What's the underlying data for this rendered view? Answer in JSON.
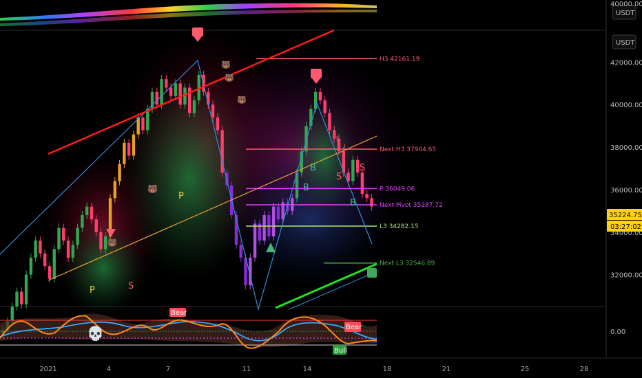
{
  "chart_data": {
    "type": "candlestick",
    "symbol_unit": "USDT",
    "x_ticks": [
      "2021",
      "4",
      "7",
      "11",
      "14",
      "18",
      "21",
      "25",
      "28"
    ],
    "y_ticks": [
      "42000.00",
      "40000.00",
      "38000.00",
      "36000.00",
      "34000.00",
      "32000.00"
    ],
    "top_pane_tick": "40000.00",
    "osc_tick": "0.00",
    "y_range": [
      30500,
      43500
    ],
    "last_price": "35224.75",
    "countdown": "03:27:02",
    "levels": [
      {
        "label": "H3 42161.19",
        "value": 42161.19,
        "color": "#ff5a6e"
      },
      {
        "label": "Next H3 37904.65",
        "value": 37904.65,
        "color": "#ff5a6e"
      },
      {
        "label": "P 36049.06",
        "value": 36049.06,
        "color": "#e040fb"
      },
      {
        "label": "Next Pivot 35287.72",
        "value": 35287.72,
        "color": "#e040fb"
      },
      {
        "label": "L3 34282.15",
        "value": 34282.15,
        "color": "#b6e36b"
      },
      {
        "label": "Next L3 32546.89",
        "value": 32546.89,
        "color": "#4caf50"
      }
    ],
    "series_close": [
      29400,
      29800,
      30500,
      31200,
      30600,
      32000,
      32800,
      33600,
      33000,
      32400,
      31800,
      33200,
      34200,
      33600,
      32800,
      33400,
      34200,
      34800,
      35200,
      34600,
      34000,
      33200,
      33800,
      35600,
      36400,
      37200,
      38200,
      37600,
      38600,
      39400,
      38800,
      39800,
      40600,
      40000,
      41200,
      40800,
      40400,
      41000,
      40000,
      40800,
      39600,
      40200,
      41400,
      40600,
      40000,
      39400,
      38800,
      36800,
      36200,
      34800,
      33400,
      32800,
      31500,
      32800,
      34400,
      33600,
      34800,
      33800,
      35200,
      34600,
      35400,
      35000,
      35600,
      36800,
      37800,
      39000,
      39800,
      40600,
      40200,
      39600,
      38800,
      38400,
      37800,
      36800,
      36400,
      37400,
      36800,
      35800,
      35600,
      35200
    ],
    "markers": [
      {
        "label": "P",
        "color": "#e8d040"
      },
      {
        "label": "S",
        "color": "#ff5a6e"
      },
      {
        "label": "P",
        "color": "#e8d040"
      },
      {
        "label": "B",
        "color": "#3fb8a0"
      },
      {
        "label": "B",
        "color": "#3fb8a0"
      },
      {
        "label": "S",
        "color": "#ff5a6e"
      },
      {
        "label": "B",
        "color": "#3fb8a0"
      },
      {
        "label": "S",
        "color": "#ff5a6e"
      },
      {
        "label": "!",
        "color": "#ff5a6e"
      },
      {
        "label": "!",
        "color": "#ff5a6e"
      }
    ],
    "osc_badges": [
      {
        "label": "Bear",
        "color": "#ff4a5a"
      },
      {
        "label": "Bear",
        "color": "#ff4a5a"
      },
      {
        "label": "Bull",
        "color": "#2e9e3e"
      }
    ],
    "colors": {
      "bull": "#2fa84f",
      "bear": "#ff3d6e",
      "zigzag": "#2f8fd8",
      "trend_red": "#ff1a1a",
      "trend_orange": "#e8a33a",
      "trend_green": "#22e022",
      "last_price_bg": "#ffd400"
    }
  }
}
